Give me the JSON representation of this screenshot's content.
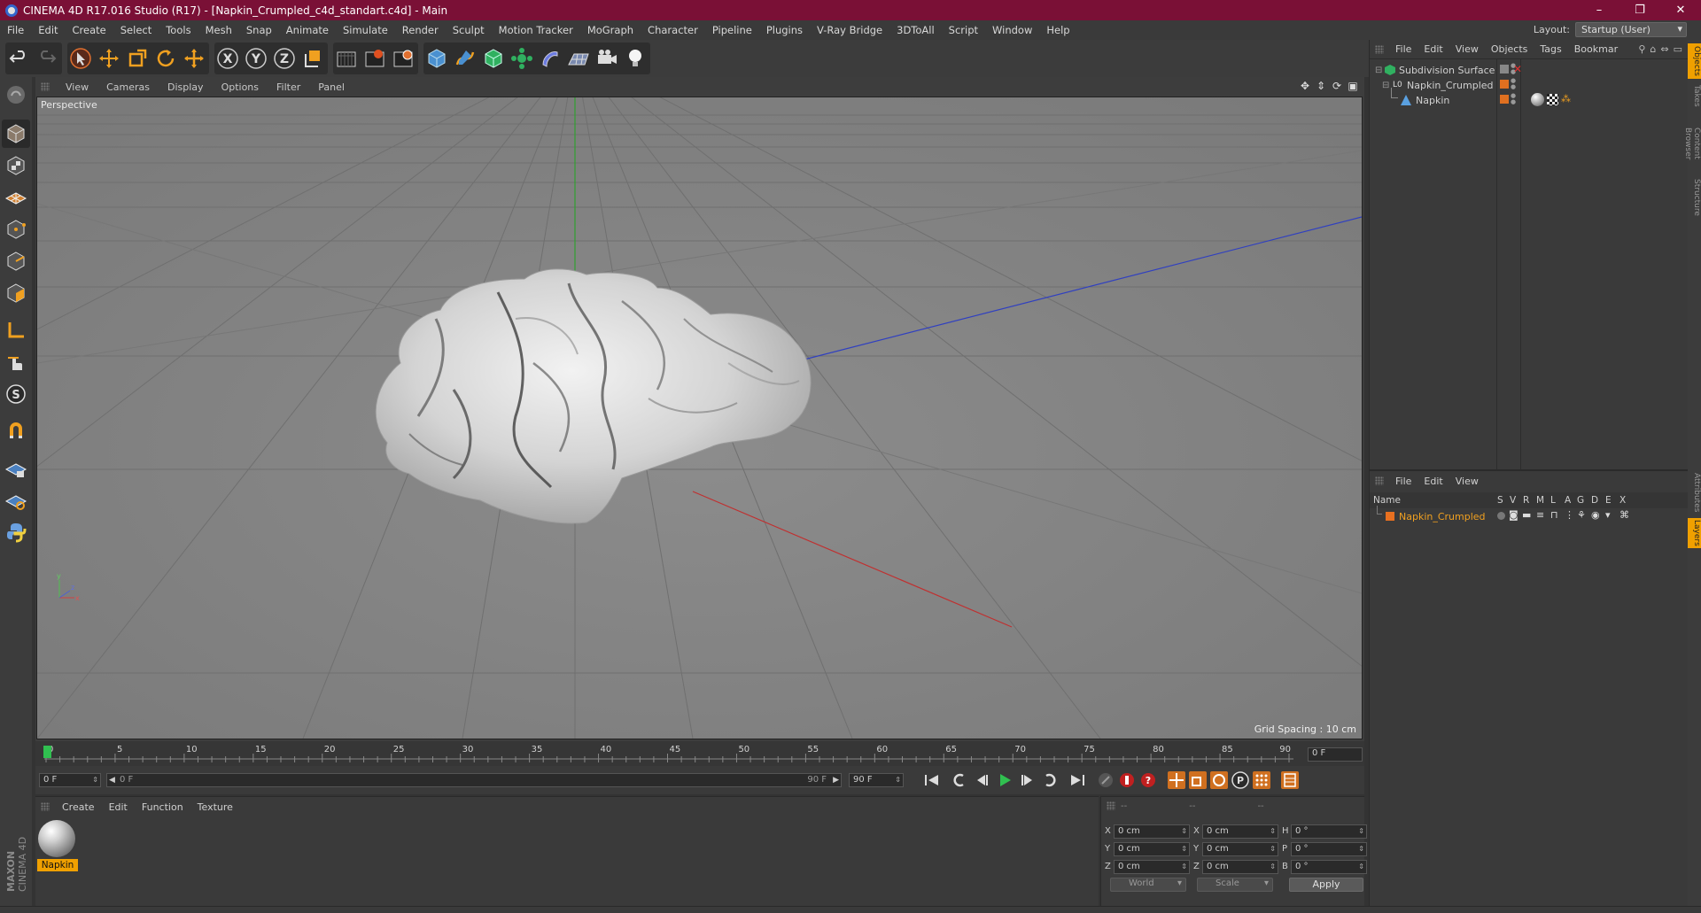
{
  "window": {
    "title": "CINEMA 4D R17.016 Studio (R17) - [Napkin_Crumpled_c4d_standart.c4d] - Main",
    "controls": {
      "minimize": "–",
      "restore": "❐",
      "close": "✕"
    }
  },
  "menubar": {
    "items": [
      "File",
      "Edit",
      "Create",
      "Select",
      "Tools",
      "Mesh",
      "Snap",
      "Animate",
      "Simulate",
      "Render",
      "Sculpt",
      "Motion Tracker",
      "MoGraph",
      "Character",
      "Pipeline",
      "Plugins",
      "V-Ray Bridge",
      "3DToAll",
      "Script",
      "Window",
      "Help"
    ],
    "layout_label": "Layout:",
    "layout_value": "Startup (User)"
  },
  "toolbar": {
    "icons": [
      "undo-icon",
      "redo-icon",
      "select-icon",
      "move-icon",
      "scale-icon",
      "rotate-icon",
      "transform-icon",
      "x-axis-icon",
      "y-axis-icon",
      "z-axis-icon",
      "coord-system-icon",
      "render-view-icon",
      "render-picture-viewer-icon",
      "render-settings-icon",
      "cube-icon",
      "pen-icon",
      "subdivision-icon",
      "mograph-icon",
      "deformer-icon",
      "floor-icon",
      "camera-icon",
      "light-icon"
    ]
  },
  "viewport": {
    "menu": [
      "View",
      "Cameras",
      "Display",
      "Options",
      "Filter",
      "Panel"
    ],
    "label": "Perspective",
    "grid_spacing": "Grid Spacing : 10 cm",
    "colors": {
      "background": "#888888",
      "x_axis": "#c03030",
      "y_axis": "#30a030",
      "z_axis": "#3040c0"
    }
  },
  "timeline": {
    "ticks": [
      "0",
      "5",
      "10",
      "15",
      "20",
      "25",
      "30",
      "35",
      "40",
      "45",
      "50",
      "55",
      "60",
      "65",
      "70",
      "75",
      "80",
      "85",
      "90"
    ],
    "current_frame": "0 F",
    "start_field": "0 F",
    "range_start": "0 F",
    "range_end": "90 F",
    "end_field": "90 F"
  },
  "material_manager": {
    "menu": [
      "Create",
      "Edit",
      "Function",
      "Texture"
    ],
    "materials": [
      {
        "name": "Napkin"
      }
    ]
  },
  "coordinates": {
    "headers": [
      "--",
      "--",
      "--"
    ],
    "rows": [
      {
        "a_label": "X",
        "a_value": "0 cm",
        "b_label": "X",
        "b_value": "0 cm",
        "c_label": "H",
        "c_value": "0 °"
      },
      {
        "a_label": "Y",
        "a_value": "0 cm",
        "b_label": "Y",
        "b_value": "0 cm",
        "c_label": "P",
        "c_value": "0 °"
      },
      {
        "a_label": "Z",
        "a_value": "0 cm",
        "b_label": "Z",
        "b_value": "0 cm",
        "c_label": "B",
        "c_value": "0 °"
      }
    ],
    "mode_dropdown": "World",
    "scale_dropdown": "Scale",
    "apply_label": "Apply"
  },
  "object_manager": {
    "menu": [
      "File",
      "Edit",
      "View",
      "Objects",
      "Tags",
      "Bookmar"
    ],
    "objects": [
      {
        "name": "Subdivision Surface"
      },
      {
        "name": "Napkin_Crumpled"
      },
      {
        "name": "Napkin"
      }
    ]
  },
  "layer_manager": {
    "menu": [
      "File",
      "Edit",
      "View"
    ],
    "columns": [
      "Name",
      "S",
      "V",
      "R",
      "M",
      "L",
      "A",
      "G",
      "D",
      "E",
      "X"
    ],
    "layers": [
      {
        "name": "Napkin_Crumpled",
        "color": "#e87020"
      }
    ]
  },
  "side_tabs": [
    "Objects",
    "Takes",
    "Content Browser",
    "Structure",
    "Attributes",
    "Layers"
  ],
  "brand": {
    "maxon": "MAXON",
    "product": "CINEMA 4D"
  }
}
